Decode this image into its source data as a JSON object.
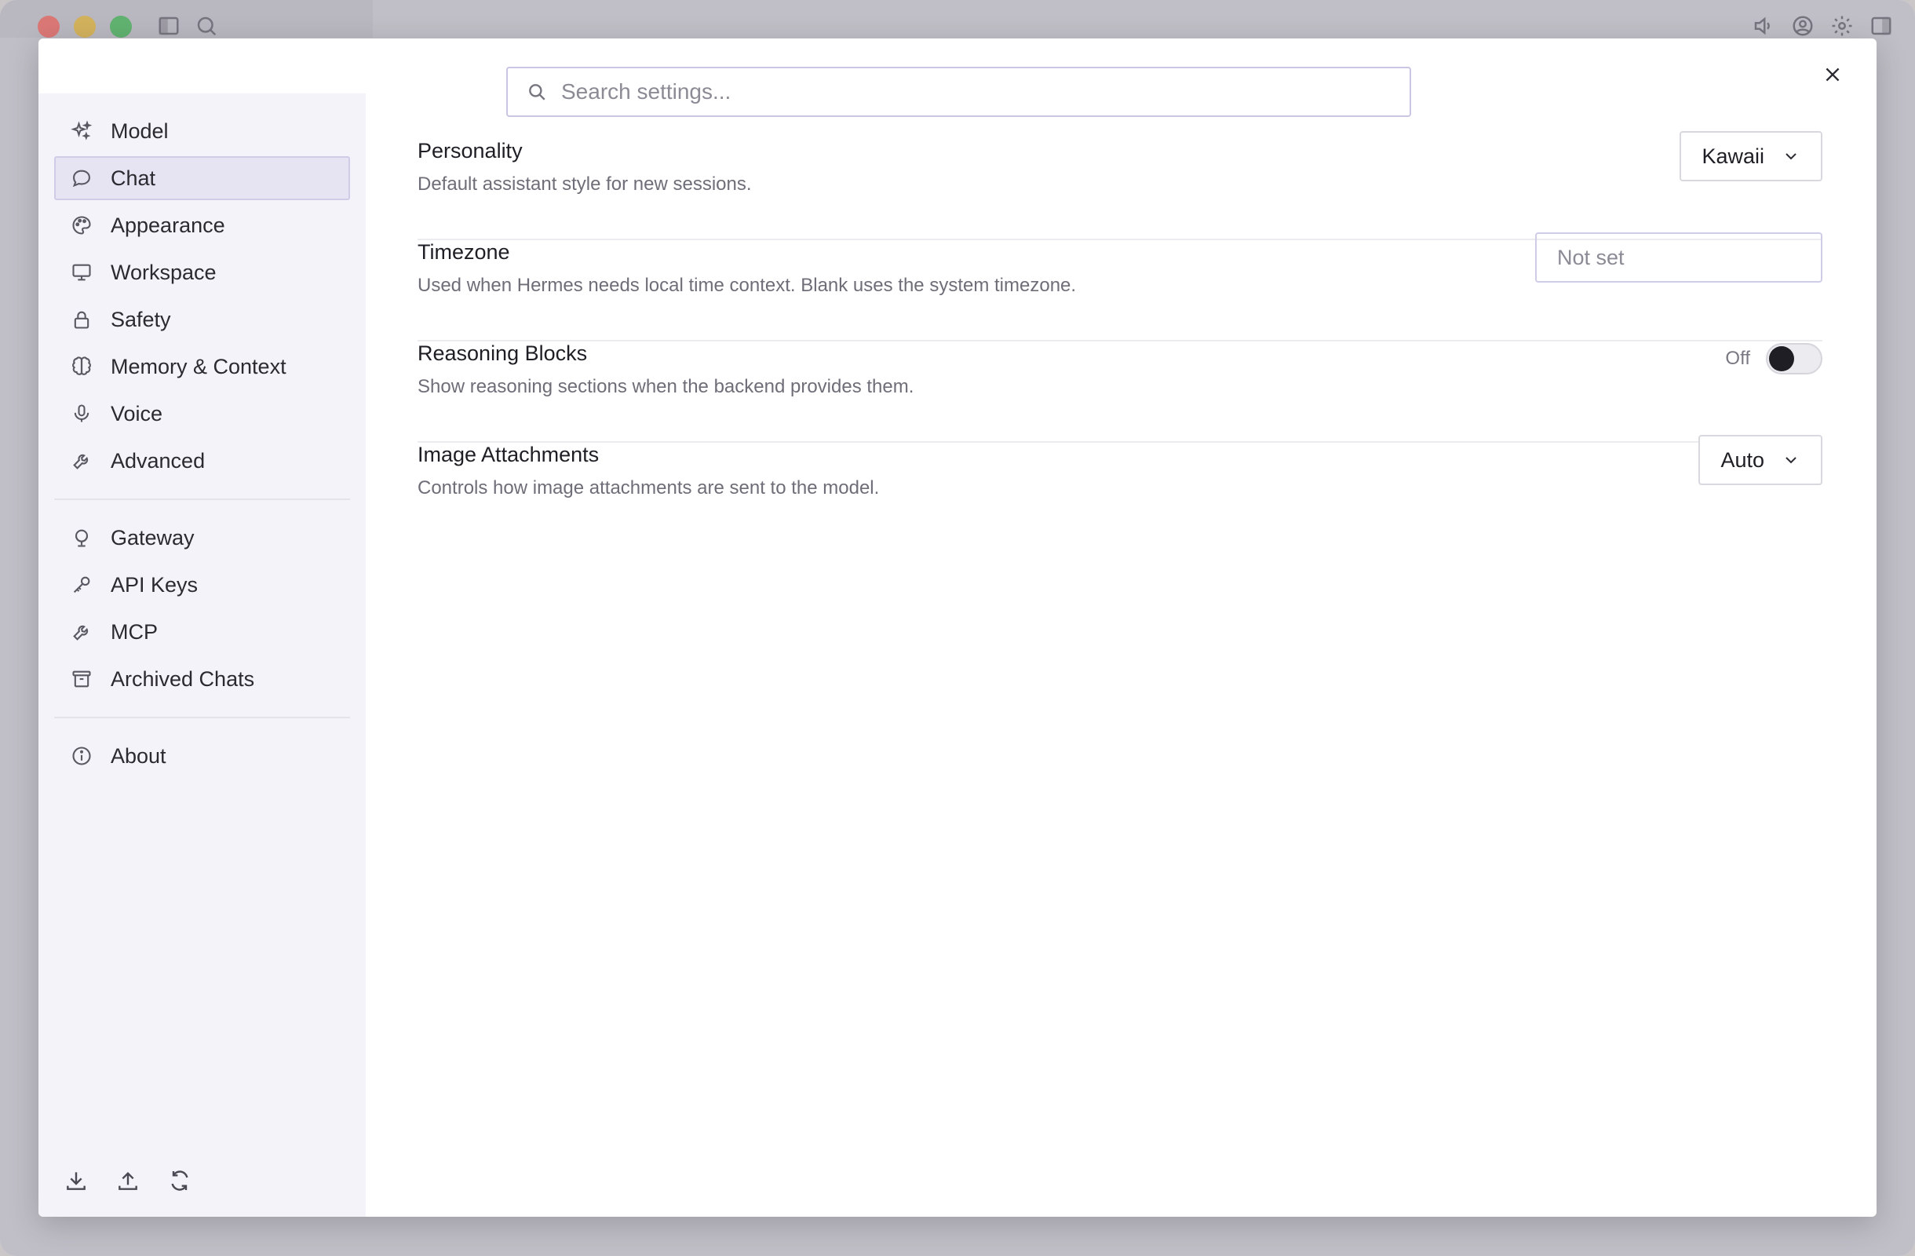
{
  "search": {
    "placeholder": "Search settings..."
  },
  "sidebar": {
    "groups": [
      [
        {
          "label": "Model",
          "icon": "sparkles-icon"
        },
        {
          "label": "Chat",
          "icon": "chat-bubble-icon",
          "active": true
        },
        {
          "label": "Appearance",
          "icon": "palette-icon"
        },
        {
          "label": "Workspace",
          "icon": "monitor-icon"
        },
        {
          "label": "Safety",
          "icon": "lock-icon"
        },
        {
          "label": "Memory & Context",
          "icon": "brain-icon"
        },
        {
          "label": "Voice",
          "icon": "microphone-icon"
        },
        {
          "label": "Advanced",
          "icon": "wrench-icon"
        }
      ],
      [
        {
          "label": "Gateway",
          "icon": "globe-stand-icon"
        },
        {
          "label": "API Keys",
          "icon": "key-icon"
        },
        {
          "label": "MCP",
          "icon": "wrench-icon"
        },
        {
          "label": "Archived Chats",
          "icon": "archive-icon"
        }
      ],
      [
        {
          "label": "About",
          "icon": "info-icon"
        }
      ]
    ],
    "footer_icons": [
      "download-icon",
      "upload-icon",
      "refresh-icon"
    ]
  },
  "settings": {
    "personality": {
      "title": "Personality",
      "description": "Default assistant style for new sessions.",
      "value": "Kawaii"
    },
    "timezone": {
      "title": "Timezone",
      "description": "Used when Hermes needs local time context. Blank uses the system timezone.",
      "placeholder": "Not set"
    },
    "reasoning_blocks": {
      "title": "Reasoning Blocks",
      "description": "Show reasoning sections when the backend provides them.",
      "state_label": "Off",
      "enabled": false
    },
    "image_attachments": {
      "title": "Image Attachments",
      "description": "Controls how image attachments are sent to the model.",
      "value": "Auto"
    }
  },
  "colors": {
    "active_nav_bg": "#e6e4f3",
    "sidebar_bg": "#f4f3f9",
    "search_border": "#c9c6e3"
  }
}
